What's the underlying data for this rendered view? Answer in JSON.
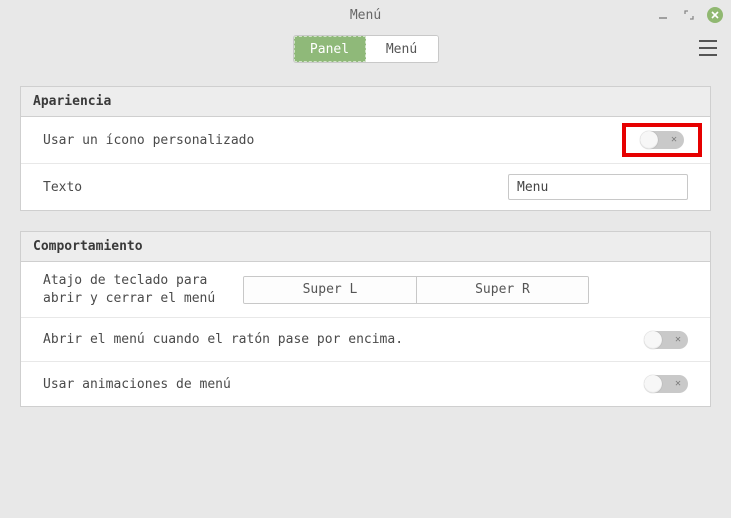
{
  "window": {
    "title": "Menú"
  },
  "tabs": {
    "panel": "Panel",
    "menu": "Menú"
  },
  "appearance": {
    "header": "Apariencia",
    "custom_icon_label": "Usar un ícono personalizado",
    "text_label": "Texto",
    "text_value": "Menu"
  },
  "behavior": {
    "header": "Comportamiento",
    "shortcut_label": "Atajo de teclado para abrir y cerrar el menú",
    "shortcut_a": "Super L",
    "shortcut_b": "Super R",
    "hover_label": "Abrir el menú cuando el ratón pase por encima.",
    "animations_label": "Usar animaciones de menú"
  }
}
